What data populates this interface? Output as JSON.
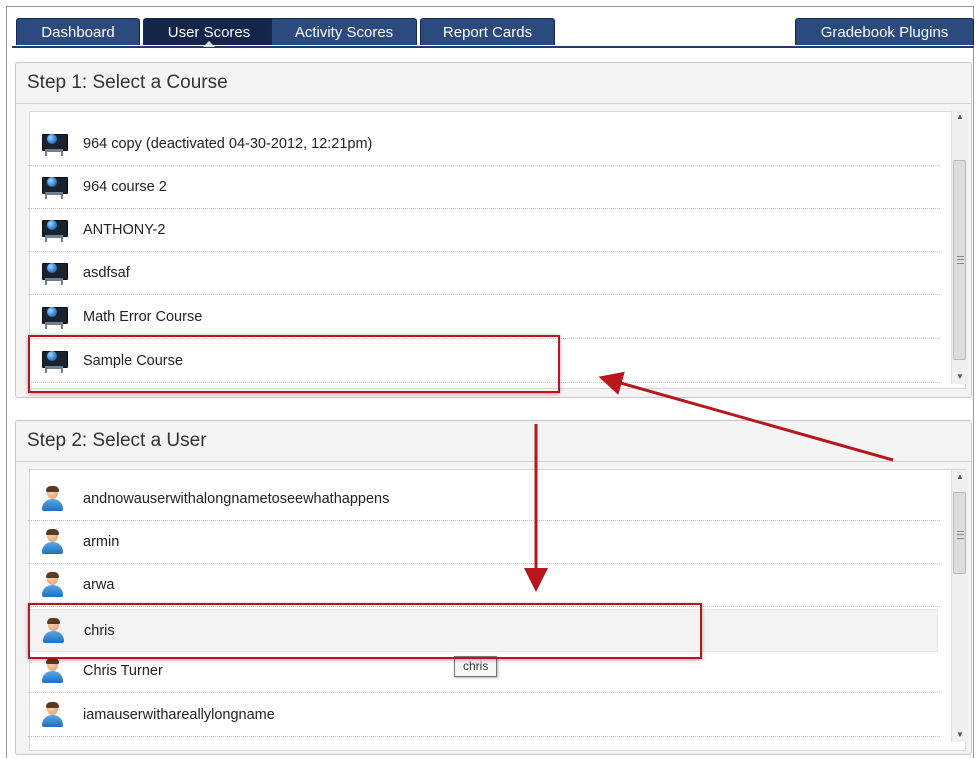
{
  "tabs": [
    {
      "label": "Dashboard",
      "active": false
    },
    {
      "label": "User Scores",
      "active": true
    },
    {
      "label": "Activity Scores",
      "active": false
    },
    {
      "label": "Report Cards",
      "active": false
    }
  ],
  "plugins_tab": {
    "label": "Gradebook Plugins"
  },
  "step1": {
    "title": "Step 1: Select a Course",
    "courses": [
      {
        "name": "964 copy (deactivated 04-30-2012, 12:21pm)",
        "icon": "course-monitor-icon"
      },
      {
        "name": "964 course 2",
        "icon": "course-monitor-icon"
      },
      {
        "name": "ANTHONY-2",
        "icon": "course-monitor-icon"
      },
      {
        "name": "asdfsaf",
        "icon": "course-monitor-icon"
      },
      {
        "name": "Math Error Course",
        "icon": "course-monitor-icon"
      },
      {
        "name": "Sample Course",
        "icon": "course-monitor-icon",
        "highlighted": true
      }
    ]
  },
  "step2": {
    "title": "Step 2: Select a User",
    "users": [
      {
        "name": "andnowauserwithalongnametoseewhathappens",
        "icon": "user-icon"
      },
      {
        "name": "armin",
        "icon": "user-icon"
      },
      {
        "name": "arwa",
        "icon": "user-icon"
      },
      {
        "name": "chris",
        "icon": "user-icon",
        "highlighted": true
      },
      {
        "name": "Chris Turner",
        "icon": "user-icon"
      },
      {
        "name": "iamauserwithareallylongname",
        "icon": "user-icon"
      }
    ]
  },
  "tooltip": {
    "text": "chris"
  },
  "colors": {
    "tab_bg": "#2b4a7e",
    "tab_active": "#13264a",
    "annotation": "#b8161b"
  }
}
